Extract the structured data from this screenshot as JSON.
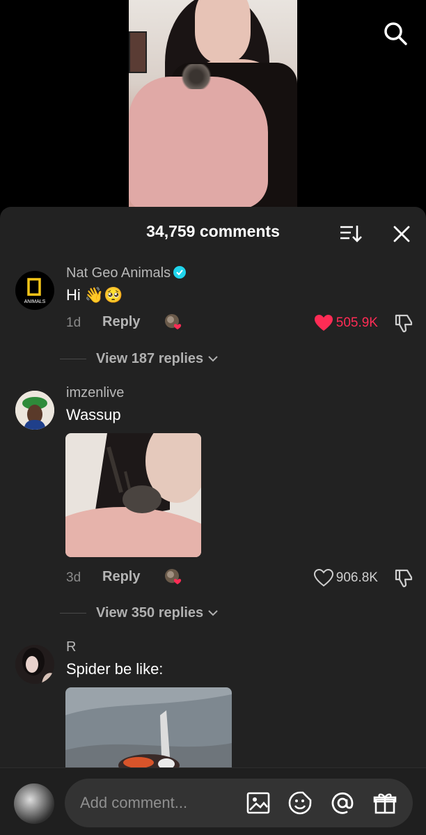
{
  "video": {
    "search_icon": "search-icon"
  },
  "header": {
    "title": "34,759 comments",
    "sort_icon": "sort-icon",
    "close_icon": "close-icon"
  },
  "comments": [
    {
      "username": "Nat Geo Animals",
      "verified": true,
      "text": "Hi 👋🥺",
      "avatar_text": "ANIMALS",
      "age": "1d",
      "reply_label": "Reply",
      "likes": "505.9K",
      "liked": true,
      "view_replies": "View 187 replies"
    },
    {
      "username": "imzenlive",
      "text": "Wassup",
      "age": "3d",
      "reply_label": "Reply",
      "likes": "906.8K",
      "liked": false,
      "view_replies": "View 350 replies"
    },
    {
      "username": "R",
      "text": "Spider be like:"
    }
  ],
  "composer": {
    "placeholder": "Add comment..."
  },
  "colors": {
    "liked": "#fe2c55",
    "verified": "#20d5ec",
    "sheet_bg": "#222222"
  }
}
